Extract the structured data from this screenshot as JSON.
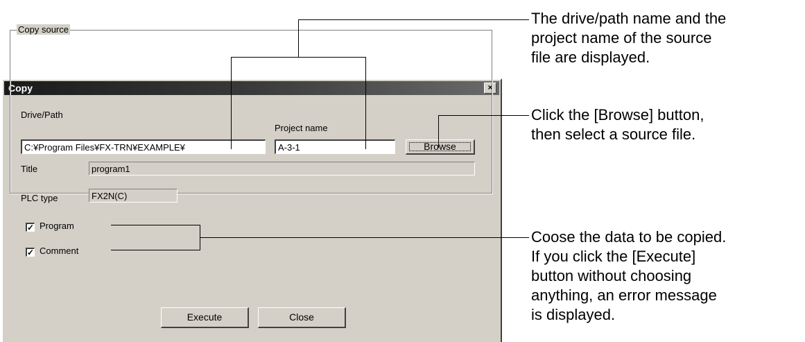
{
  "dialog": {
    "title": "Copy",
    "close_glyph": "×",
    "group_label": "Copy source",
    "drive_path_label": "Drive/Path",
    "drive_path_value": "C:¥Program Files¥FX-TRN¥EXAMPLE¥",
    "project_name_label": "Project name",
    "project_name_value": "A-3-1",
    "browse_label": "Browse",
    "title_label": "Title",
    "title_value": "program1",
    "plc_type_label": "PLC type",
    "plc_type_value": "FX2N(C)",
    "program_label": "Program",
    "program_checked": true,
    "comment_label": "Comment",
    "comment_checked": true,
    "check_glyph": "✓",
    "execute_label": "Execute",
    "close_label": "Close"
  },
  "callouts": {
    "path_note": [
      "The drive/path name and the",
      "project name of the source",
      "file are displayed."
    ],
    "browse_note": [
      "Click the [Browse] button,",
      "then select a source file."
    ],
    "data_note": [
      "Coose the data to be copied.",
      "If you click the [Execute]",
      "button without choosing",
      "anything, an error message",
      "is displayed."
    ]
  },
  "icons": {
    "close": "close-icon",
    "checkbox": "checkmark-icon"
  }
}
